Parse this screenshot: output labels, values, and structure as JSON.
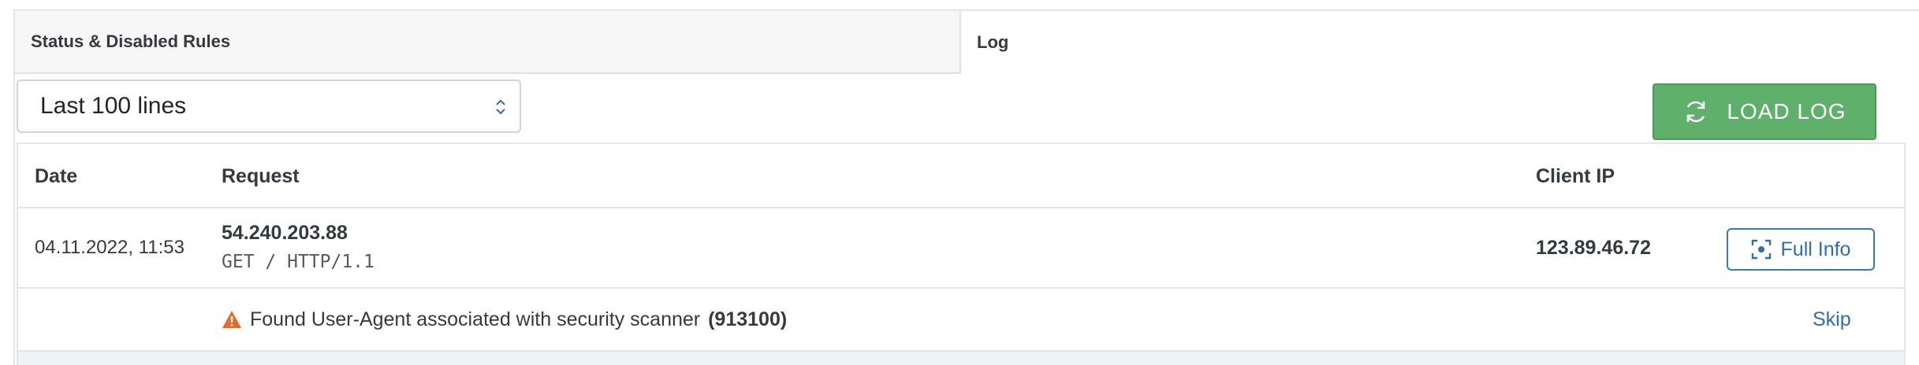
{
  "tabs": [
    {
      "label": "Status & Disabled Rules"
    },
    {
      "label": "Log"
    }
  ],
  "controls": {
    "lines_select": {
      "value": "Last 100 lines"
    },
    "load_button": {
      "label": "LOAD LOG",
      "icon": "refresh-icon"
    }
  },
  "table": {
    "headers": {
      "date": "Date",
      "request": "Request",
      "client_ip": "Client IP"
    },
    "rows": [
      {
        "date": "04.11.2022, 11:53",
        "host": "54.240.203.88",
        "request_line": "GET / HTTP/1.1",
        "client_ip": "123.89.46.72",
        "action_label": "Full Info",
        "action_icon": "focus-icon",
        "finding": {
          "text": "Found User-Agent associated with security scanner",
          "rule_id": "(913100)",
          "icon": "warning-icon",
          "action_label": "Skip"
        }
      }
    ]
  },
  "colors": {
    "primary_button": "#5fb06a",
    "link": "#2f6eaa",
    "warning": "#e8692c"
  }
}
